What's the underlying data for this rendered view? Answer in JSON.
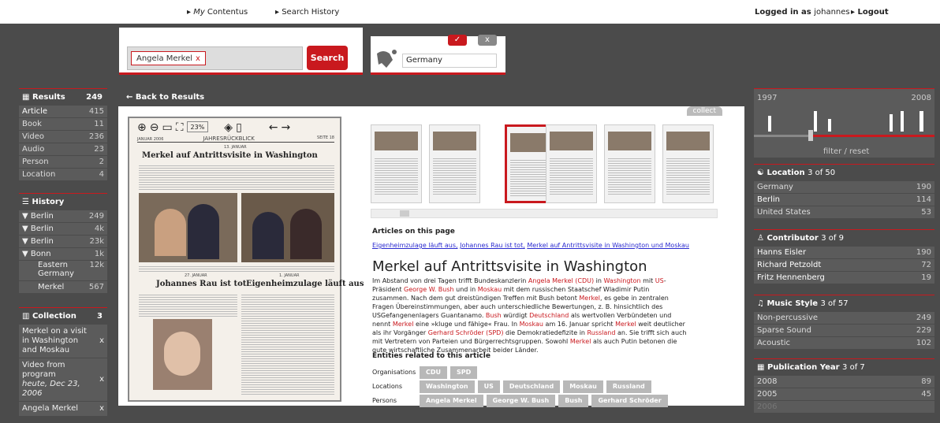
{
  "topbar": {
    "my_prefix": "My",
    "my_contentus": " Contentus",
    "search_history": "Search History",
    "logged_in_label": "Logged in as",
    "user": "johannes",
    "logout": "Logout"
  },
  "search": {
    "tag": "Angela Merkel",
    "tag_remove": "x",
    "button": "Search"
  },
  "geo": {
    "value": "Germany",
    "ok": "✓",
    "close": "x"
  },
  "left": {
    "results": {
      "title": "Results",
      "count": "249",
      "items": [
        {
          "label": "Article",
          "count": "415"
        },
        {
          "label": "Book",
          "count": "11"
        },
        {
          "label": "Video",
          "count": "236"
        },
        {
          "label": "Audio",
          "count": "23"
        },
        {
          "label": "Person",
          "count": "2"
        },
        {
          "label": "Location",
          "count": "4"
        }
      ]
    },
    "history": {
      "title": "History",
      "items": [
        {
          "label": "Berlin",
          "count": "249"
        },
        {
          "label": "Berlin",
          "count": "4k"
        },
        {
          "label": "Berlin",
          "count": "23k"
        },
        {
          "label": "Bonn",
          "count": "1k"
        },
        {
          "label": "Eastern Germany",
          "count": "12k"
        },
        {
          "label": "Merkel",
          "count": "567"
        }
      ]
    },
    "collection": {
      "title": "Collection",
      "count": "3",
      "items": [
        {
          "label": "Merkel on a visit in Washington and Moskau"
        },
        {
          "label": "Video from program",
          "sub": "heute, Dec 23, 2006"
        },
        {
          "label": "Angela Merkel"
        }
      ],
      "remove": "x"
    }
  },
  "main": {
    "back": "← Back to Results",
    "collect": "collect",
    "zoom": "23%",
    "scan": {
      "header_left": "JANUAR 2006",
      "header_mid": "JAHRESRÜCKBLICK",
      "header_right": "SEITE 18",
      "date1": "13. JANUAR",
      "headline1": "Merkel auf Antrittsvisite in Washington",
      "date2": "27. JANUAR",
      "headline2": "Johannes Rau ist tot",
      "date3": "1. JANUAR",
      "headline3": "Eigenheimzulage läuft aus"
    },
    "articles_heading": "Articles on this page",
    "article_links": [
      "Eigenheimzulage läuft aus,",
      "Johannes Rau ist tot,",
      "Merkel auf Antrittsvisite in Washington und Moskau"
    ],
    "title": "Merkel auf Antrittsvisite in Washington",
    "body": [
      {
        "t": "Im Abstand von drei Tagen trifft Bundeskanzlerin "
      },
      {
        "t": "Angela Merkel (CDU)",
        "hl": true
      },
      {
        "t": " in "
      },
      {
        "t": "Washington",
        "hl": true
      },
      {
        "t": " mit "
      },
      {
        "t": "US",
        "hl": true
      },
      {
        "t": "-Präsident "
      },
      {
        "t": "George W. Bush",
        "hl": true
      },
      {
        "t": " und in "
      },
      {
        "t": "Moskau",
        "hl": true
      },
      {
        "t": " mit dem russischen Staatschef Wladimir Putin zusammen. Nach dem gut dreistündigen Treffen mit Bush betont "
      },
      {
        "t": "Merkel",
        "hl": true
      },
      {
        "t": ", es gebe in zentralen Fragen Übereinstimmungen, aber auch unterschiedliche Bewertungen, z. B. hinsichtlich des USGefangenenlagers Guantanamo. "
      },
      {
        "t": "Bush",
        "hl": true
      },
      {
        "t": " würdigt "
      },
      {
        "t": "Deutschland",
        "hl": true
      },
      {
        "t": " als wertvollen Verbündeten und nennt "
      },
      {
        "t": "Merkel",
        "hl": true
      },
      {
        "t": " eine »kluge und fähige« Frau. In "
      },
      {
        "t": "Moskau",
        "hl": true
      },
      {
        "t": " am 16. Januar spricht "
      },
      {
        "t": "Merkel",
        "hl": true
      },
      {
        "t": " weit deutlicher als ihr Vorgänger "
      },
      {
        "t": "Gerhard Schröder (SPD)",
        "hl": true
      },
      {
        "t": " die Demokratiedefizite in "
      },
      {
        "t": "Russland",
        "hl": true
      },
      {
        "t": " an. Sie trifft sich auch mit Vertretern von Parteien und Bürgerrechtsgruppen. Sowohl "
      },
      {
        "t": "Merkel",
        "hl": true
      },
      {
        "t": " als auch Putin betonen die gute wirtschaftliche Zusammenarbeit beider Länder."
      }
    ],
    "entities_heading": "Entities related to this article",
    "entities": [
      {
        "label": "Organisations",
        "values": [
          "CDU",
          "SPD"
        ]
      },
      {
        "label": "Locations",
        "values": [
          "Washington",
          "US",
          "Deutschland",
          "Moskau",
          "Russland"
        ]
      },
      {
        "label": "Persons",
        "values": [
          "Angela Merkel",
          "George W. Bush",
          "Bush",
          "Gerhard Schröder"
        ]
      }
    ]
  },
  "right": {
    "timeline": {
      "start": "1997",
      "end": "2008",
      "filter": "filter",
      "sep": " / ",
      "reset": "reset",
      "selection": 0.7
    },
    "location": {
      "title": "Location",
      "of": "3 of 50",
      "items": [
        {
          "label": "Germany",
          "count": "190"
        },
        {
          "label": "Berlin",
          "count": "114"
        },
        {
          "label": "United States",
          "count": "53"
        }
      ]
    },
    "contributor": {
      "title": "Contributor",
      "of": "3 of 9",
      "items": [
        {
          "label": "Hanns Eisler",
          "count": "190"
        },
        {
          "label": "Richard Petzoldt",
          "count": "72"
        },
        {
          "label": "Fritz Hennenberg",
          "count": "19"
        }
      ]
    },
    "music": {
      "title": "Music Style",
      "of": "3 of 57",
      "items": [
        {
          "label": "Non-percussive",
          "count": "249"
        },
        {
          "label": "Sparse Sound",
          "count": "229"
        },
        {
          "label": "Acoustic",
          "count": "102"
        }
      ]
    },
    "pubyear": {
      "title": "Publication Year",
      "of": "3 of 7",
      "items": [
        {
          "label": "2008",
          "count": "89"
        },
        {
          "label": "2005",
          "count": "45"
        },
        {
          "label": "2006",
          "count": ""
        }
      ]
    }
  },
  "colors": {
    "accent": "#c9191e",
    "bg": "#4b4b4b",
    "panel": "#5b5b5b"
  }
}
